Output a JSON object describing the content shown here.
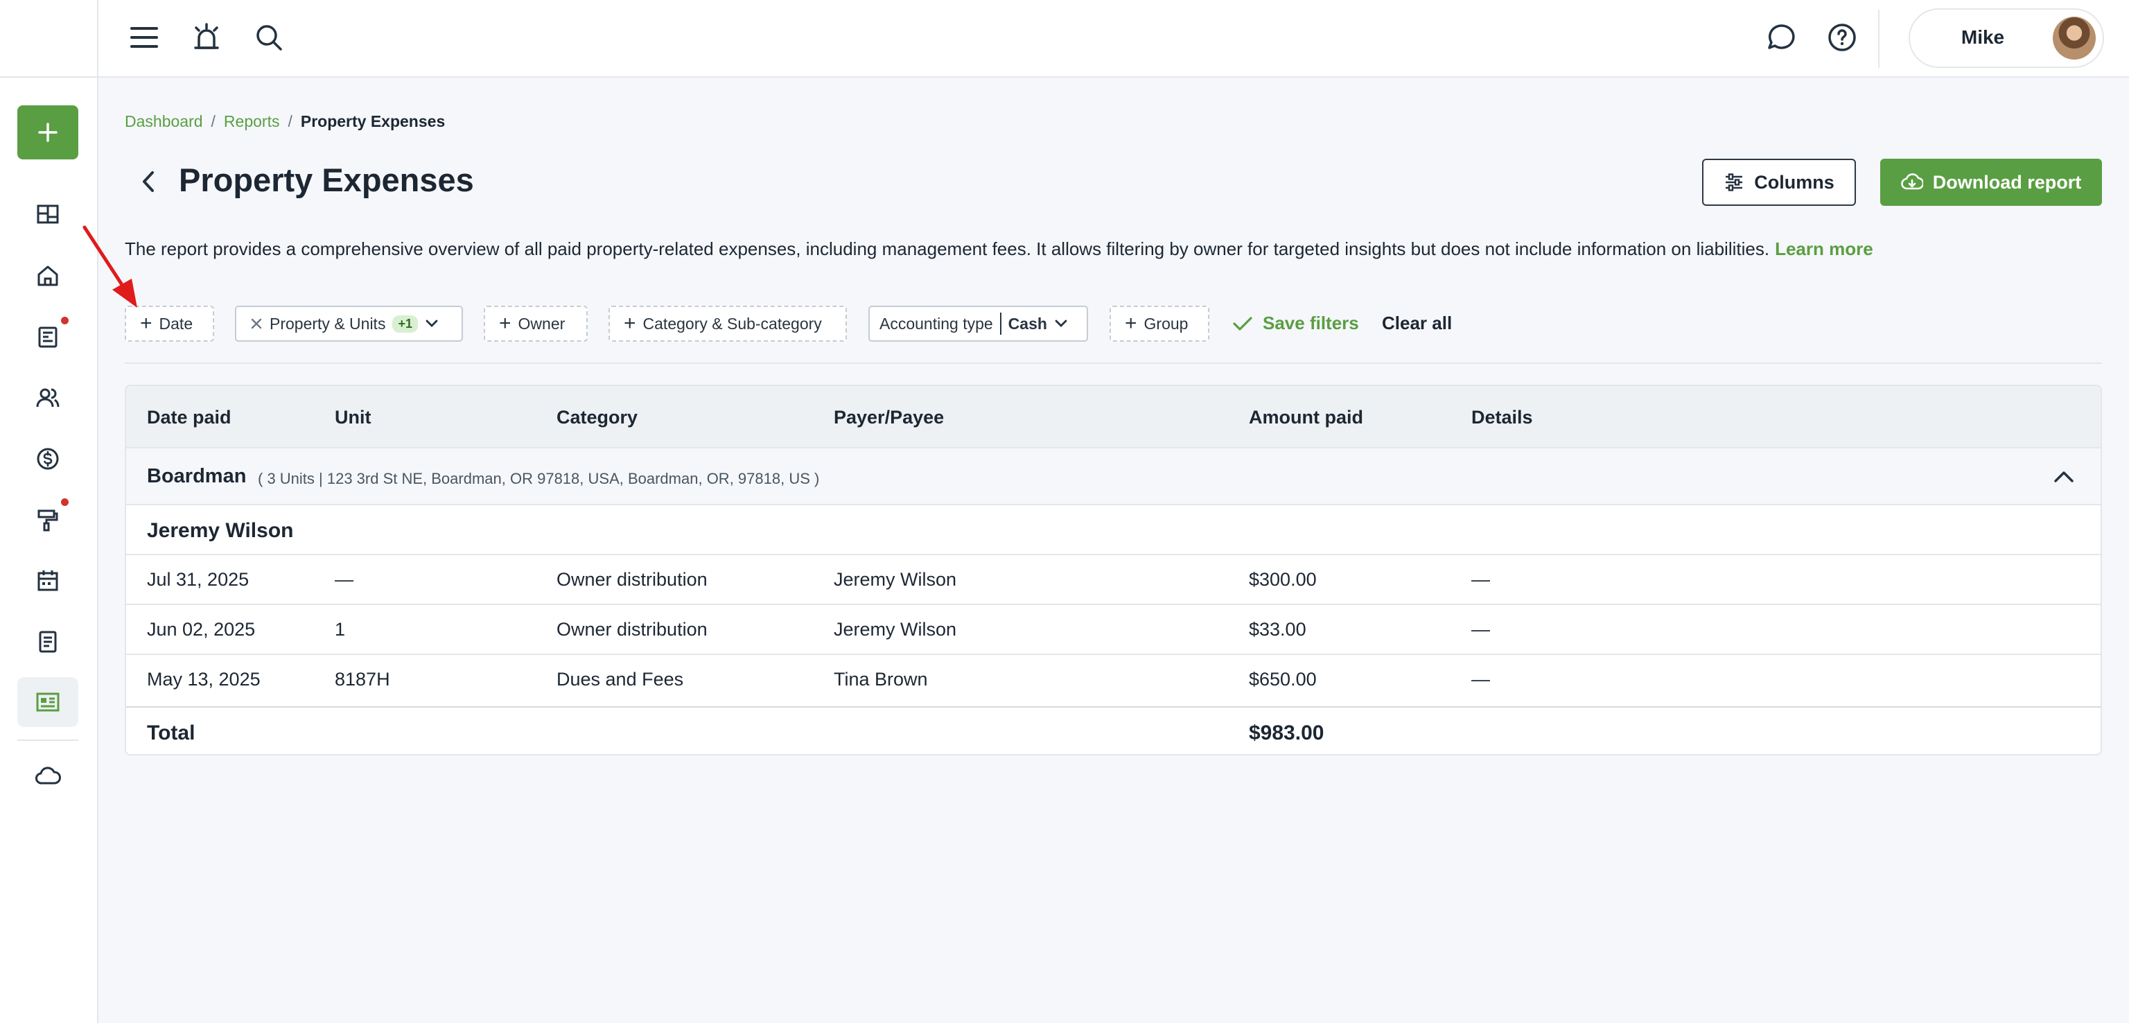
{
  "header": {
    "user_name": "Mike",
    "icons": [
      "menu-icon",
      "alert-icon",
      "search-icon",
      "chat-icon",
      "help-icon"
    ]
  },
  "sidebar": {
    "items": [
      {
        "name": "dashboard-icon"
      },
      {
        "name": "home-icon"
      },
      {
        "name": "news-icon",
        "dot": true
      },
      {
        "name": "people-icon"
      },
      {
        "name": "dollar-icon"
      },
      {
        "name": "paint-roller-icon",
        "dot": true
      },
      {
        "name": "calendar-icon"
      },
      {
        "name": "document-icon"
      },
      {
        "name": "reports-icon",
        "active": true
      },
      {
        "name": "cloud-icon"
      }
    ]
  },
  "breadcrumb": {
    "items": [
      "Dashboard",
      "Reports",
      "Property Expenses"
    ]
  },
  "page": {
    "title": "Property Expenses",
    "columns_button": "Columns",
    "download_button": "Download report",
    "description": "The report provides a comprehensive overview of all paid property-related expenses, including management fees. It allows filtering by owner for targeted insights but does not include information on liabilities.",
    "learn_more": "Learn more"
  },
  "filters": {
    "date": "Date",
    "property_units": "Property & Units",
    "property_units_badge": "+1",
    "owner": "Owner",
    "category": "Category & Sub-category",
    "accounting_type_label": "Accounting type",
    "accounting_type_value": "Cash",
    "group": "Group",
    "save_filters": "Save filters",
    "clear_all": "Clear all"
  },
  "table": {
    "columns": [
      "Date paid",
      "Unit",
      "Category",
      "Payer/Payee",
      "Amount paid",
      "Details"
    ],
    "group": {
      "name": "Boardman",
      "detail": "( 3 Units | 123 3rd St NE, Boardman, OR 97818, USA, Boardman, OR, 97818, US )"
    },
    "owner": "Jeremy Wilson",
    "rows": [
      {
        "date": "Jul 31, 2025",
        "unit": "—",
        "category": "Owner distribution",
        "payee": "Jeremy Wilson",
        "amount": "$300.00",
        "details": "—"
      },
      {
        "date": "Jun 02, 2025",
        "unit": "1",
        "category": "Owner distribution",
        "payee": "Jeremy Wilson",
        "amount": "$33.00",
        "details": "—"
      },
      {
        "date": "May 13, 2025",
        "unit": "8187H",
        "category": "Dues and Fees",
        "payee": "Tina Brown",
        "amount": "$650.00",
        "details": "—"
      }
    ],
    "total_label": "Total",
    "total_amount": "$983.00"
  },
  "colors": {
    "brand_green": "#5a9e43",
    "annotation_red": "#e01b1b",
    "notification_dot": "#d0342c"
  }
}
